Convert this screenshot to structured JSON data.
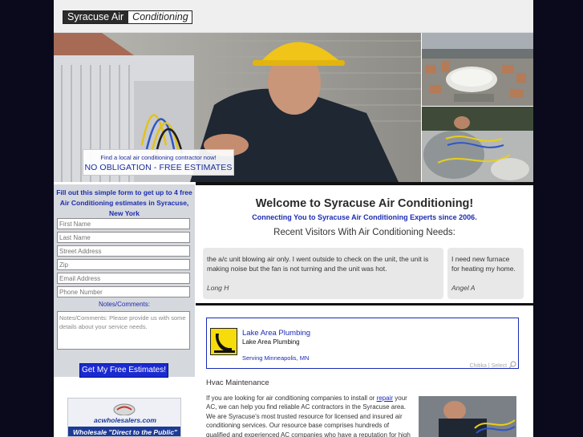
{
  "site": {
    "logo_part1": "Syracuse Air",
    "logo_part2": "Conditioning"
  },
  "hero": {
    "promo_small": "Find a local air conditioning contractor now!",
    "promo_big": "NO OBLIGATION - FREE ESTIMATES"
  },
  "form": {
    "title": "Fill out this simple form to get up to 4 free Air Conditioning estimates in Syracuse, New York",
    "first_name_placeholder": "First Name",
    "last_name_placeholder": "Last Name",
    "street_placeholder": "Street Address",
    "zip_placeholder": "Zip",
    "email_placeholder": "Email Address",
    "phone_placeholder": "Phone Number",
    "notes_label": "Notes/Comments:",
    "notes_placeholder": "Notes/Comments: Please provide us with some details about your service needs.",
    "submit_label": "Get My Free Estimates!"
  },
  "ad": {
    "logo_text": "acwholesalers.com",
    "tagline": "Wholesale \"Direct to the Public\""
  },
  "main": {
    "welcome": "Welcome to Syracuse Air Conditioning!",
    "tagline": "Connecting You to Syracuse Air Conditioning Experts since 2006.",
    "recent_heading": "Recent Visitors With Air Conditioning Needs:"
  },
  "visitors": [
    {
      "text": "the a/c unit blowing air only. I went outside to check on the unit, the unit is making noise but the fan is not turning and the unit was hot.",
      "name": "Long H"
    },
    {
      "text": "I need new furnace for heating my home.",
      "name": "Angel A"
    }
  ],
  "listing": {
    "title": "Lake Area Plumbing",
    "subtitle": "Lake Area Plumbing",
    "location": "Serving Minneapolis, MN",
    "footer": "Chitika | Select"
  },
  "hvac": {
    "title": "Hvac Maintenance",
    "text_before_link": "If you are looking for air conditioning companies to install or ",
    "link_text": "repair",
    "text_after_link": " your AC, we can help you find reliable AC contractors in the Syracuse area. We are Syracuse's most trusted resource for licensed and insured air conditioning services. Our resource base comprises hundreds of qualified and experienced AC companies who have a reputation for high quality and"
  },
  "colors": {
    "brand_blue": "#1d2cb0",
    "form_panel": "#d5d8dd",
    "button_blue": "#1b2ad0",
    "rule": "#111111"
  }
}
